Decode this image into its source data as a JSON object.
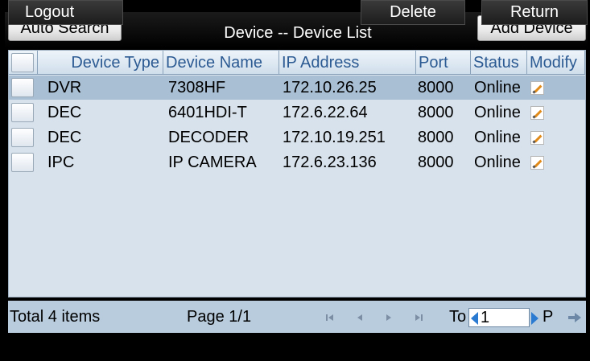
{
  "header": {
    "title": "Device -- Device List",
    "auto_search_label": "Auto Search",
    "add_device_label": "Add Device"
  },
  "table": {
    "columns": [
      "Device Type",
      "Device Name",
      "IP Address",
      "Port",
      "Status",
      "Modify"
    ],
    "rows": [
      {
        "type": "DVR",
        "name": "7308HF",
        "ip": "172.10.26.25",
        "port": "8000",
        "status": "Online",
        "selected": true
      },
      {
        "type": "DEC",
        "name": "6401HDI-T",
        "ip": "172.6.22.64",
        "port": "8000",
        "status": "Online",
        "selected": false
      },
      {
        "type": "DEC",
        "name": "DECODER",
        "ip": "172.10.19.251",
        "port": "8000",
        "status": "Online",
        "selected": false
      },
      {
        "type": "IPC",
        "name": "IP CAMERA",
        "ip": "172.6.23.136",
        "port": "8000",
        "status": "Online",
        "selected": false
      }
    ]
  },
  "pager": {
    "total": "Total 4 items",
    "page": "Page 1/1",
    "goto_label": "To",
    "goto_value": "1",
    "page_suffix": "P"
  },
  "footer": {
    "logout_label": "Logout",
    "delete_label": "Delete",
    "return_label": "Return"
  },
  "colors": {
    "header_text": "#2c5a92",
    "row_bg": "#d8e2ec",
    "row_selected_bg": "#a9bfd4",
    "pager_bg": "#b8ccdd",
    "accent_arrow": "#2a7ad1"
  }
}
